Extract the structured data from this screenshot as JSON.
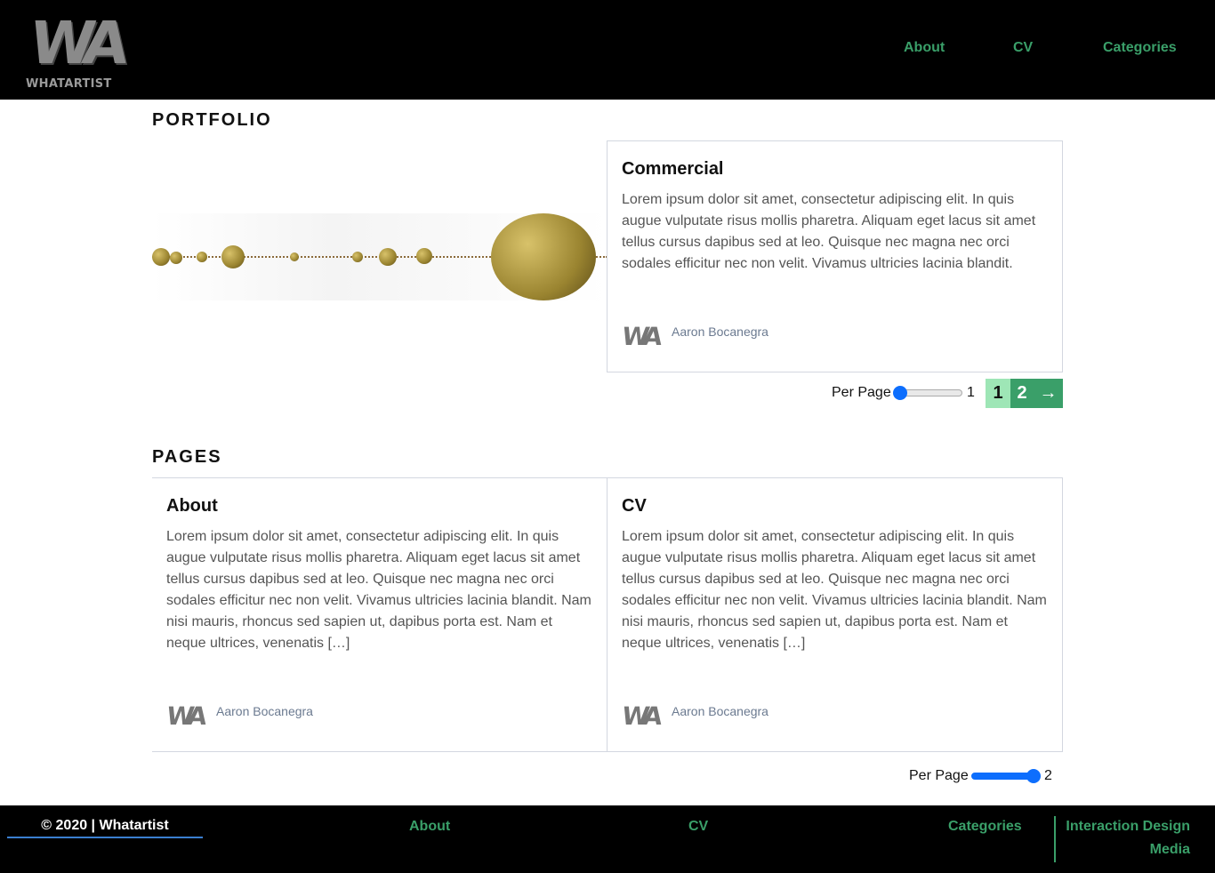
{
  "header": {
    "logo_text": "WHATARTIST",
    "logo_mark": "WA",
    "nav": [
      "About",
      "CV",
      "Categories"
    ]
  },
  "portfolio": {
    "heading": "PORTFOLIO",
    "card": {
      "title": "Commercial",
      "body": "Lorem ipsum dolor sit amet, consectetur adipiscing elit. In quis augue vulputate risus mollis pharetra. Aliquam eget lacus sit amet tellus cursus dapibus sed at leo. Quisque nec magna nec orci sodales efficitur nec non velit. Vivamus ultricies lacinia blandit.",
      "author": "Aaron Bocanegra"
    },
    "per_page_label": "Per Page",
    "per_page_value": "1",
    "per_page_fraction": 0,
    "pages": [
      "1",
      "2"
    ],
    "next": "→"
  },
  "pages": {
    "heading": "PAGES",
    "cards": [
      {
        "title": "About",
        "body": "Lorem ipsum dolor sit amet, consectetur adipiscing elit. In quis augue vulputate risus mollis pharetra. Aliquam eget lacus sit amet tellus cursus dapibus sed at leo. Quisque nec magna nec orci sodales efficitur nec non velit. Vivamus ultricies lacinia blandit. Nam nisi mauris, rhoncus sed sapien ut, dapibus porta est. Nam et neque ultrices, venenatis […]",
        "author": "Aaron Bocanegra"
      },
      {
        "title": "CV",
        "body": "Lorem ipsum dolor sit amet, consectetur adipiscing elit. In quis augue vulputate risus mollis pharetra. Aliquam eget lacus sit amet tellus cursus dapibus sed at leo. Quisque nec magna nec orci sodales efficitur nec non velit. Vivamus ultricies lacinia blandit. Nam nisi mauris, rhoncus sed sapien ut, dapibus porta est. Nam et neque ultrices, venenatis […]",
        "author": "Aaron Bocanegra"
      }
    ],
    "per_page_label": "Per Page",
    "per_page_value": "2",
    "per_page_fraction": 1
  },
  "footer": {
    "copyright": "© 2020 | Whatartist",
    "links": [
      "About",
      "CV",
      "Categories"
    ],
    "sub_links": [
      "Interaction Design",
      "Media"
    ]
  },
  "colors": {
    "accent": "#3a9f69",
    "active_page": "#9ee6b6",
    "slider": "#0d6efd"
  }
}
